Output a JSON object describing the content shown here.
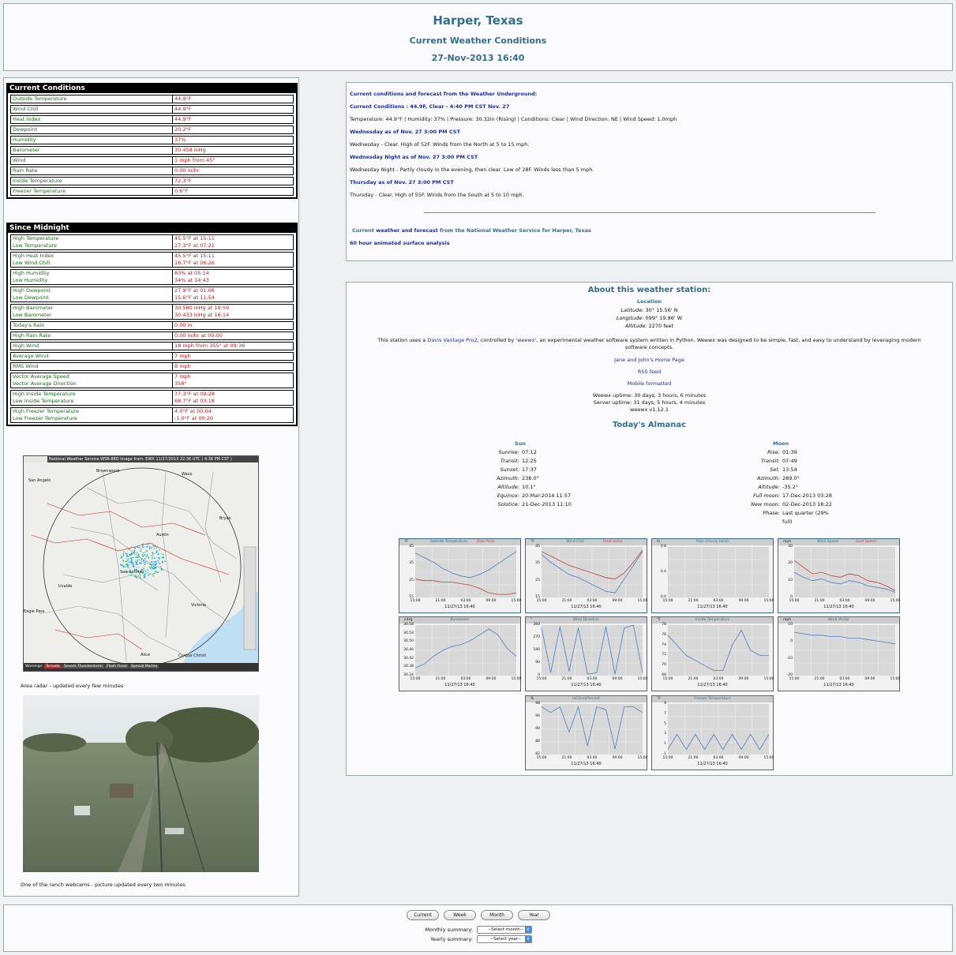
{
  "header": {
    "location": "Harper, Texas",
    "subtitle": "Current Weather Conditions",
    "datetime": "27-Nov-2013 16:40"
  },
  "current": {
    "title": "Current Conditions",
    "rows": [
      {
        "label": "Outside Temperature",
        "value": "44.9°F"
      },
      {
        "label": "Wind Chill",
        "value": "44.9°F"
      },
      {
        "label": "Heat Index",
        "value": "44.9°F"
      },
      {
        "label": "Dewpoint",
        "value": "20.2°F"
      },
      {
        "label": "Humidity",
        "value": "37%"
      },
      {
        "label": "Barometer",
        "value": "30.458 inHg"
      },
      {
        "label": "Wind",
        "value": "1 mph from 45°"
      },
      {
        "label": "Rain Rate",
        "value": "0.00 in/hr"
      },
      {
        "label": "Inside Temperature",
        "value": "72.3°F"
      },
      {
        "label": "Freezer Temperature",
        "value": "0.6°F"
      }
    ]
  },
  "midnight": {
    "title": "Since Midnight",
    "rows": [
      {
        "l1": "High Temperature",
        "l2": "Low Temperature",
        "v1": "45.5°F at 15:11",
        "v2": "27.3°F at 07:21"
      },
      {
        "l1": "High Heat Index",
        "l2": "Low Wind Chill",
        "v1": "45.5°F at 15:11",
        "v2": "16.7°F at 06:26"
      },
      {
        "l1": "High Humidity",
        "l2": "Low Humidity",
        "v1": "83% at 05:14",
        "v2": "34% at 14:43"
      },
      {
        "l1": "High Dewpoint",
        "l2": "Low Dewpoint",
        "v1": "27.9°F at 01:06",
        "v2": "15.6°F at 11:54"
      },
      {
        "l1": "High Barometer",
        "l2": "Low Barometer",
        "v1": "30.580 inHg at 10:59",
        "v2": "30.433 inHg at 16:14"
      },
      {
        "l1": "Today's Rain",
        "l2": "",
        "v1": "0.00 in",
        "v2": ""
      },
      {
        "l1": "High Rain Rate",
        "l2": "",
        "v1": "0.00 in/hr at 00:00",
        "v2": ""
      },
      {
        "l1": "High Wind",
        "l2": "",
        "v1": "18 mph from 355° at 09:36",
        "v2": ""
      },
      {
        "l1": "Average Wind",
        "l2": "",
        "v1": "7 mph",
        "v2": ""
      },
      {
        "l1": "RMS Wind",
        "l2": "",
        "v1": "8 mph",
        "v2": ""
      },
      {
        "l1": "Vector Average Speed",
        "l2": "Vector Average Direction",
        "v1": "7 mph",
        "v2": "358°"
      },
      {
        "l1": "High Inside Temperature",
        "l2": "Low Inside Temperature",
        "v1": "77.3°F at 09:28",
        "v2": "68.7°F at 03:18"
      },
      {
        "l1": "High Freezer Temperature",
        "l2": "Low Freezer Temperature",
        "v1": "4.0°F at 00:04",
        "v2": "-1.0°F at 00:20"
      }
    ]
  },
  "radar": {
    "banner": "National Weather Service WSR-88D Image from: EWX 11/27/2013 22:36 UTC ( 4:36 PM CST )",
    "cities": [
      "San Angelo",
      "Brownwood",
      "Waco",
      "Bryan",
      "Austin",
      "San Antonio",
      "Uvalde",
      "Eagle Pass",
      "Victoria",
      "Alice",
      "Corpus Christi"
    ],
    "legend": [
      "Warnings:",
      "Tornado",
      "Severe Thunderstorm",
      "Flash Flood",
      "Special Marine"
    ],
    "caption": "Area radar - updated every few minutes"
  },
  "webcam": {
    "caption": "One of the ranch webcams - picture updated every two minutes"
  },
  "wu": {
    "title": "Current conditions and forecast from the Weather Underground:",
    "current_head": "Current Conditions : 44.9F, Clear - 4:40 PM CST Nov. 27",
    "current_text": "Temperature: 44.9°F | Humidity: 37% | Pressure: 30.32in (Rising) | Conditions: Clear | Wind Direction: NE | Wind Speed: 1.0mph",
    "f1_head": "Wednesday as of Nov. 27 3:00 PM CST",
    "f1_text": "Wednesday - Clear. High of 52F. Winds from the North at 5 to 15 mph.",
    "f2_head": "Wednesday Night as of Nov. 27 3:00 PM CST",
    "f2_text": "Wednesday Night - Partly cloudy in the evening, then clear. Low of 28F. Winds less than 5 mph.",
    "f3_head": "Thursday as of Nov. 27 3:00 PM CST",
    "f3_text": "Thursday - Clear. High of 55F. Winds from the South at 5 to 10 mph.",
    "nws_pre": "Current",
    "nws_link": "weather and forecast",
    "nws_post": "from the National Weather Service for Harper, Texas",
    "surface": "60 hour animated surface analysis"
  },
  "about": {
    "title": "About this weather station:",
    "location_head": "Location",
    "latitude_label": "Latitude:",
    "latitude": "30° 15.56' N",
    "longitude_label": "Longitude:",
    "longitude": "099° 19.86' W",
    "altitude_label": "Altitude:",
    "altitude": "2270 feet",
    "desc_pre": "This station uses a",
    "desc_link": "Davis Vantage Pro2",
    "desc_mid": ", controlled by",
    "desc_link2": "'weewx'",
    "desc_post": ", an experimental weather software system written in Python. Weewx was designed to be simple, fast, and easy to understand by leveraging modern software concepts.",
    "link1": "Jane and John's Home Page",
    "link2": "RSS feed",
    "link3": "Mobile formatted",
    "uptime1": "Weewx uptime: 30 days, 3 hours, 6 minutes",
    "uptime2": "Server uptime: 31 days, 5 hours, 4 minutes",
    "version": "weewx v1.12.1"
  },
  "almanac": {
    "title": "Today's Almanac",
    "sun_head": "Sun",
    "sun": [
      {
        "k": "Sunrise:",
        "v": "07:12"
      },
      {
        "k": "Transit:",
        "v": "12:25"
      },
      {
        "k": "Sunset:",
        "v": "17:37"
      },
      {
        "k": "Azimuth:",
        "v": "238.0°"
      },
      {
        "k": "Altitude:",
        "v": "10.1°"
      },
      {
        "k": "Equinox:",
        "v": "20-Mar-2014 11:57"
      },
      {
        "k": "Solstice:",
        "v": "21-Dec-2013 11:10"
      }
    ],
    "moon_head": "Moon",
    "moon": [
      {
        "k": "Rise:",
        "v": "01:39"
      },
      {
        "k": "Transit:",
        "v": "07:49"
      },
      {
        "k": "Set:",
        "v": "13:54"
      },
      {
        "k": "Azimuth:",
        "v": "289.0°"
      },
      {
        "k": "Altitude:",
        "v": "-35.2°"
      },
      {
        "k": "Full moon:",
        "v": "17-Dec-2013 03:28"
      },
      {
        "k": "New moon:",
        "v": "02-Dec-2013 18:22"
      },
      {
        "k": "Phase:",
        "v": "Last quarter (29% full)"
      }
    ]
  },
  "graphs": [
    {
      "unit": "°F",
      "title": "Outside Temperature",
      "title2": "Dew Point",
      "yticks": [
        "45",
        "35",
        "25",
        "15"
      ],
      "xticks": [
        "15:00",
        "21:00",
        "03:00",
        "09:00",
        "15:00"
      ],
      "xlabel": "11/27/13 16:40",
      "series": [
        {
          "color": "#4a7fc0",
          "values": [
            44,
            41,
            38,
            34,
            31,
            29,
            28,
            30,
            33,
            37,
            41,
            45
          ]
        },
        {
          "color": "#c04040",
          "values": [
            27,
            26,
            26,
            25,
            25,
            24,
            23,
            21,
            18,
            17,
            17,
            18
          ]
        }
      ],
      "ymin": 15,
      "ymax": 48
    },
    {
      "unit": "°F",
      "title": "Wind Chill",
      "title2": "Heat Index",
      "yticks": [
        "45",
        "35",
        "25",
        "15"
      ],
      "xticks": [
        "15:00",
        "21:00",
        "03:00",
        "09:00",
        "15:00"
      ],
      "xlabel": "11/27/13 16:40",
      "series": [
        {
          "color": "#4a7fc0",
          "values": [
            43,
            38,
            34,
            30,
            28,
            25,
            22,
            19,
            18,
            27,
            36,
            45
          ]
        },
        {
          "color": "#c04040",
          "values": [
            45,
            42,
            39,
            36,
            34,
            32,
            30,
            28,
            27,
            31,
            38,
            46
          ]
        }
      ],
      "ymin": 15,
      "ymax": 48
    },
    {
      "unit": "in",
      "title": "Rain (hourly total)",
      "title2": "",
      "yticks": [
        "0.8",
        "0.4",
        "0.0"
      ],
      "xticks": [
        "15:00",
        "21:00",
        "03:00",
        "09:00",
        "15:00"
      ],
      "xlabel": "11/27/13 16:40",
      "series": [],
      "ymin": 0,
      "ymax": 1
    },
    {
      "unit": "mph",
      "title": "Wind Speed",
      "title2": "Gust Speed",
      "yticks": [
        "30",
        "20",
        "10",
        "0"
      ],
      "xticks": [
        "15:00",
        "21:00",
        "03:00",
        "09:00",
        "15:00"
      ],
      "xlabel": "11/27/13 16:40",
      "series": [
        {
          "color": "#4a7fc0",
          "values": [
            15,
            12,
            10,
            11,
            9,
            8,
            10,
            9,
            7,
            6,
            5,
            3
          ]
        },
        {
          "color": "#c04040",
          "values": [
            22,
            18,
            14,
            15,
            13,
            12,
            14,
            13,
            10,
            9,
            7,
            4
          ]
        }
      ],
      "ymin": 0,
      "ymax": 30
    },
    {
      "unit": "inHg",
      "title": "Barometer",
      "title2": "",
      "yticks": [
        "30.58",
        "30.54",
        "30.50",
        "30.46",
        "30.42",
        "30.38",
        "30.34"
      ],
      "xticks": [
        "15:00",
        "21:00",
        "03:00",
        "09:00",
        "15:00"
      ],
      "xlabel": "11/27/13 16:40",
      "series": [
        {
          "color": "#4a7fc0",
          "values": [
            30.38,
            30.4,
            30.44,
            30.47,
            30.49,
            30.5,
            30.52,
            30.55,
            30.58,
            30.55,
            30.48,
            30.44
          ]
        }
      ],
      "ymin": 30.34,
      "ymax": 30.6
    },
    {
      "unit": "°",
      "title": "Wind Direction",
      "title2": "",
      "yticks": [
        "360",
        "270",
        "180",
        "90",
        "0"
      ],
      "xticks": [
        "15:00",
        "21:00",
        "03:00",
        "09:00",
        "15:00"
      ],
      "xlabel": "11/27/13 16:40",
      "series": [
        {
          "color": "#4a7fc0",
          "values": [
            340,
            20,
            350,
            30,
            340,
            10,
            20,
            350,
            10,
            340,
            360,
            20
          ]
        }
      ],
      "ymin": 0,
      "ymax": 360
    },
    {
      "unit": "°F",
      "title": "Inside Temperature",
      "title2": "",
      "yticks": [
        "78",
        "76",
        "74",
        "72",
        "70",
        "68"
      ],
      "xticks": [
        "15:00",
        "21:00",
        "03:00",
        "09:00",
        "15:00"
      ],
      "xlabel": "11/27/13 16:40",
      "series": [
        {
          "color": "#4a7fc0",
          "values": [
            76,
            74,
            72,
            71,
            70,
            69,
            69,
            74,
            77,
            73,
            72,
            72
          ]
        }
      ],
      "ymin": 68,
      "ymax": 78
    },
    {
      "unit": "mph",
      "title": "Wind Vector",
      "title2": "",
      "yticks": [
        "10",
        "0",
        "-10",
        "-20"
      ],
      "xticks": [
        "15:00",
        "21:00",
        "03:00",
        "09:00",
        "15:00"
      ],
      "xlabel": "11/27/13 16:40",
      "series": [
        {
          "color": "#4a7fc0",
          "values": [
            10,
            9,
            8,
            8,
            7,
            7,
            6,
            6,
            5,
            4,
            3,
            2
          ]
        }
      ],
      "ymin": -20,
      "ymax": 15
    },
    {
      "unit": "%",
      "title": "rxCheckPercent",
      "title2": "",
      "yticks": [
        "98",
        "94",
        "90",
        "86",
        "82"
      ],
      "xticks": [
        "15:00",
        "21:00",
        "03:00",
        "09:00",
        "15:00"
      ],
      "xlabel": "11/27/13 16:40",
      "series": [
        {
          "color": "#4a7fc0",
          "values": [
            99,
            97,
            99,
            90,
            99,
            85,
            99,
            98,
            84,
            99,
            99,
            97
          ]
        }
      ],
      "ymin": 82,
      "ymax": 100
    },
    {
      "unit": "°F",
      "title": "Freezer Temperature",
      "title2": "",
      "yticks": [
        "9",
        "7",
        "5",
        "3",
        "1",
        "-1"
      ],
      "xticks": [
        "15:00",
        "21:00",
        "03:00",
        "09:00",
        "15:00"
      ],
      "xlabel": "11/27/13 16:40",
      "series": [
        {
          "color": "#4a7fc0",
          "values": [
            0,
            3,
            0,
            3,
            0,
            3,
            0,
            3,
            0,
            3,
            0,
            3
          ]
        }
      ],
      "ymin": -1,
      "ymax": 9
    }
  ],
  "footer": {
    "buttons": [
      "Current",
      "Week",
      "Month",
      "Year"
    ],
    "monthly_label": "Monthly summary:",
    "monthly_select": "--Select month--",
    "yearly_label": "Yearly summary:",
    "yearly_select": "--Select year--"
  }
}
